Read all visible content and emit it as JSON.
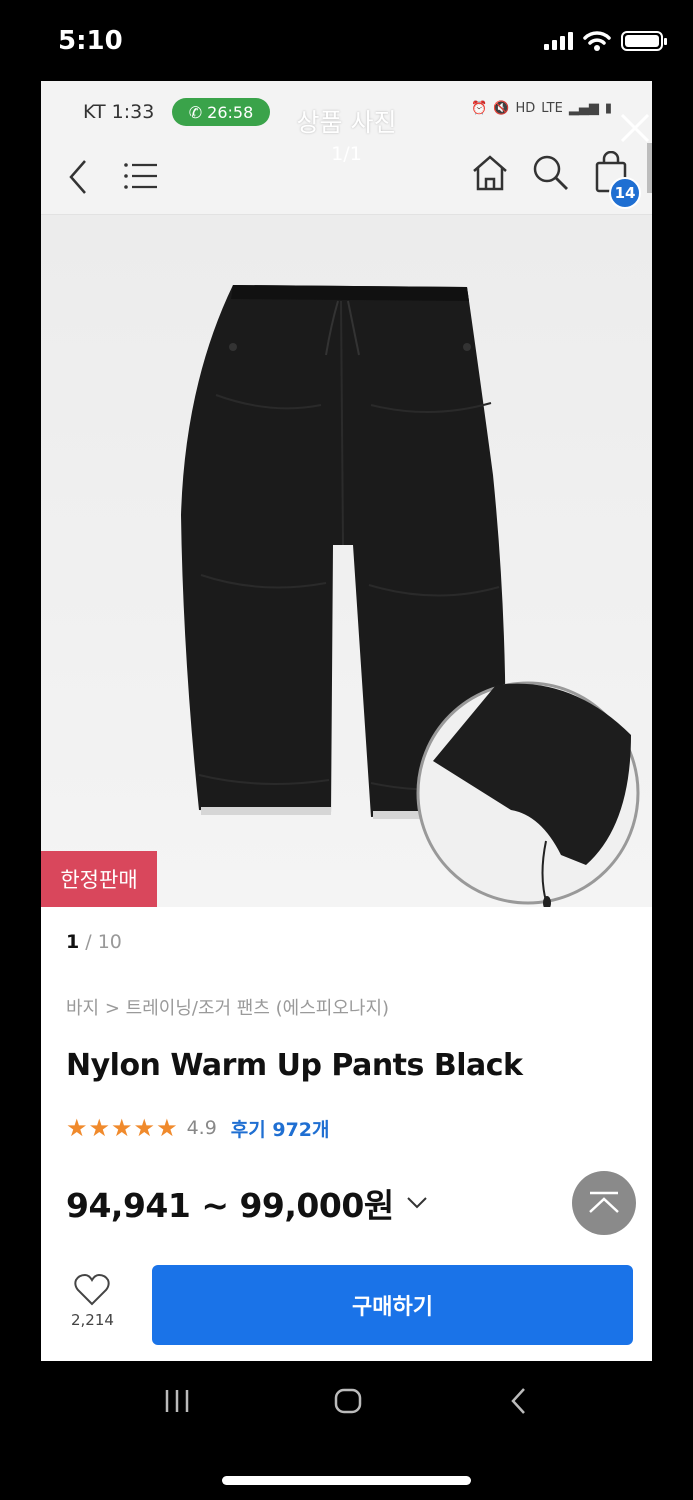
{
  "ios_status": {
    "time": "5:10"
  },
  "inner_status": {
    "carrier_time": "KT 1:33",
    "call_timer": "26:58",
    "icons": [
      "alarm-icon",
      "mute-icon",
      "HD",
      "LTE",
      "signal-icon",
      "battery-icon"
    ]
  },
  "viewer": {
    "title": "상품 사진",
    "counter": "1/1"
  },
  "topbar": {
    "cart_count": "14"
  },
  "product": {
    "limited_label": "한정판매",
    "image_index": "1",
    "image_total": "/ 10",
    "breadcrumb": "바지 > 트레이닝/조거 팬츠 (에스피오나지)",
    "name": "Nylon Warm Up Pants Black",
    "stars": "★★★★★",
    "rating": "4.9",
    "reviews": "후기 972개",
    "price": "94,941 ~ 99,000원"
  },
  "bottom": {
    "like_count": "2,214",
    "buy_label": "구매하기"
  },
  "colors": {
    "accent": "#1a73e8",
    "badge": "#1f6fd2",
    "limited": "#d9475c",
    "stars": "#f08a2c",
    "call": "#3aa34a"
  }
}
